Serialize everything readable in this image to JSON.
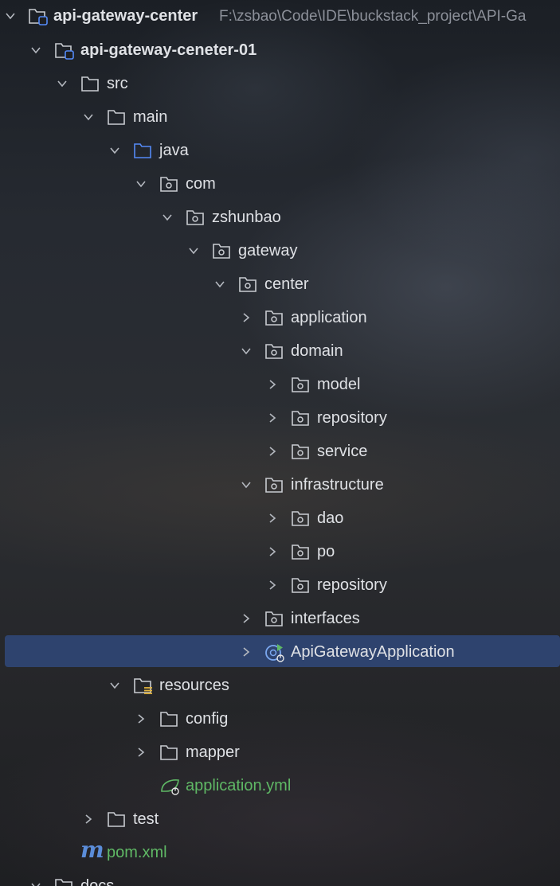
{
  "project_tree": {
    "root": {
      "label": "api-gateway-center",
      "path_hint": "F:\\zsbao\\Code\\IDE\\buckstack_project\\API-Ga"
    },
    "module": {
      "label": "api-gateway-ceneter-01"
    },
    "src": {
      "label": "src"
    },
    "main": {
      "label": "main"
    },
    "java": {
      "label": "java"
    },
    "com": {
      "label": "com"
    },
    "zshunbao": {
      "label": "zshunbao"
    },
    "gateway": {
      "label": "gateway"
    },
    "center": {
      "label": "center"
    },
    "application": {
      "label": "application"
    },
    "domain": {
      "label": "domain"
    },
    "domain_model": {
      "label": "model"
    },
    "domain_repository": {
      "label": "repository"
    },
    "domain_service": {
      "label": "service"
    },
    "infrastructure": {
      "label": "infrastructure"
    },
    "infra_dao": {
      "label": "dao"
    },
    "infra_po": {
      "label": "po"
    },
    "infra_repository": {
      "label": "repository"
    },
    "interfaces": {
      "label": "interfaces"
    },
    "app_class": {
      "label": "ApiGatewayApplication",
      "selected": true
    },
    "resources": {
      "label": "resources"
    },
    "config": {
      "label": "config"
    },
    "mapper": {
      "label": "mapper"
    },
    "application_yml": {
      "label": "application.yml"
    },
    "test": {
      "label": "test"
    },
    "pom": {
      "label": "pom.xml"
    },
    "docs": {
      "label": "docs"
    }
  },
  "colors": {
    "selection": "#2e436e",
    "text": "#dfe1e5",
    "path_hint": "#8c9099",
    "config_file_text": "#5fb865",
    "source_folder_blue": "#548af7",
    "maven_icon": "#5b8dd9"
  },
  "icons": {
    "expanded": "chevron-down-icon",
    "collapsed": "chevron-right-icon",
    "module": "module-folder-icon",
    "folder": "folder-icon",
    "source_root": "source-folder-icon",
    "package": "package-folder-icon",
    "resources": "resources-folder-icon",
    "spring_boot_class": "spring-boot-class-icon",
    "spring_config": "spring-config-icon",
    "maven": "maven-icon"
  }
}
